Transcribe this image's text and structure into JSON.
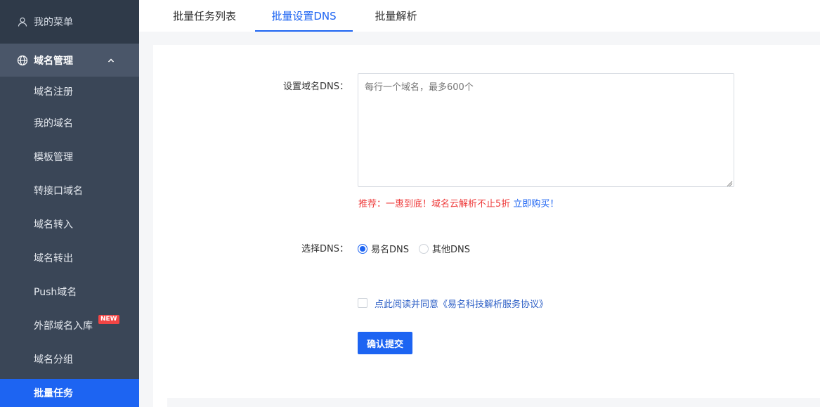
{
  "sidebar": {
    "top_item": "我的菜单",
    "group": "域名管理",
    "items": [
      {
        "label": "域名注册"
      },
      {
        "label": "我的域名"
      },
      {
        "label": "模板管理"
      },
      {
        "label": "转接口域名"
      },
      {
        "label": "域名转入"
      },
      {
        "label": "域名转出"
      },
      {
        "label": "Push域名"
      },
      {
        "label": "外部域名入库",
        "badge": "NEW"
      },
      {
        "label": "域名分组"
      },
      {
        "label": "批量任务"
      }
    ]
  },
  "tabs": [
    {
      "label": "批量任务列表"
    },
    {
      "label": "批量设置DNS"
    },
    {
      "label": "批量解析"
    }
  ],
  "form": {
    "dns_label": "设置域名DNS：",
    "dns_placeholder": "每行一个域名，最多600个",
    "promo_red": "推荐：一惠到底！域名云解析不止5折",
    "promo_link": "立即购买！",
    "select_label": "选择DNS：",
    "radio_options": [
      {
        "label": "易名DNS",
        "checked": true
      },
      {
        "label": "其他DNS",
        "checked": false
      }
    ],
    "agree_text": "点此阅读并同意《易名科技解析服务协议》",
    "submit_label": "确认提交"
  },
  "colors": {
    "accent": "#1d64f2",
    "sidebar_bg": "#3a4657",
    "promo_red": "#ee3b3b"
  }
}
